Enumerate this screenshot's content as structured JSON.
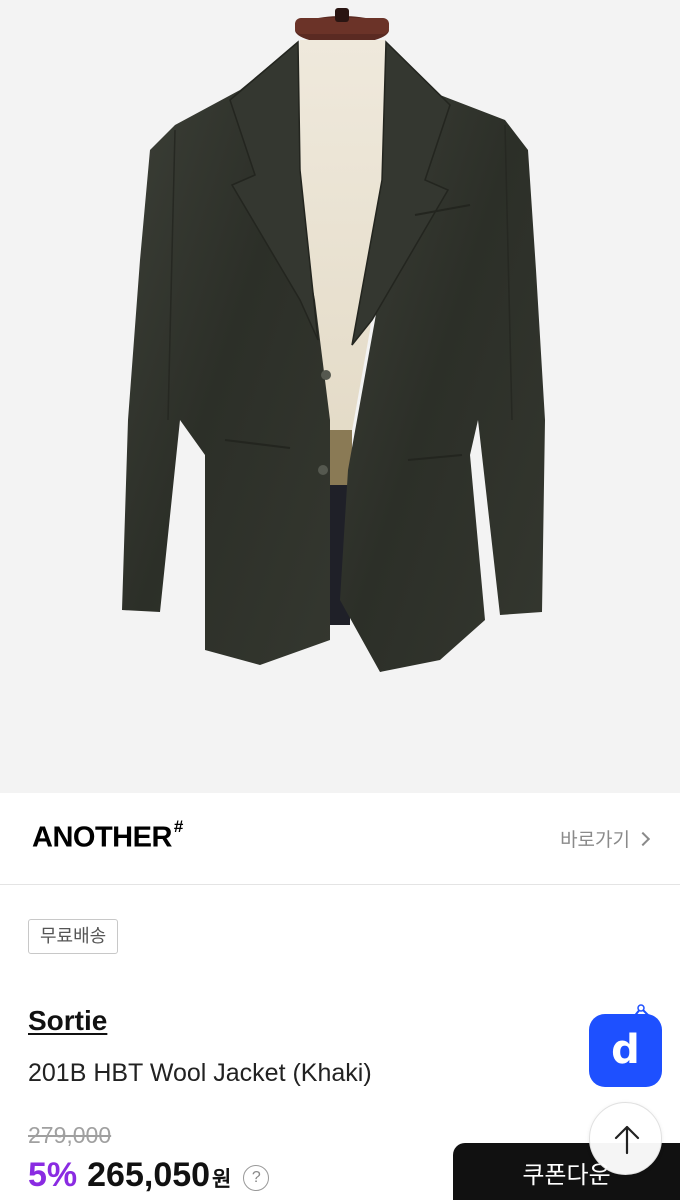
{
  "product_image": {
    "alt": "khaki wool jacket on mannequin",
    "bg_color": "#f3f3f3"
  },
  "brand": {
    "logo_text": "ANOTHER",
    "logo_mark": "#",
    "link_label": "바로가기"
  },
  "badge": {
    "label": "무료배송"
  },
  "product": {
    "seller": "Sortie",
    "name": "201B HBT Wool Jacket (Khaki)",
    "original_price": "279,000",
    "discount": "5%",
    "sale_price": "265,050",
    "currency": "원",
    "help_symbol": "?"
  },
  "actions": {
    "coupon_label": "쿠폰다운",
    "app_button_letter": "d"
  },
  "colors": {
    "discount": "#8a2be2",
    "app_button": "#1e50ff",
    "coupon_button": "#111111"
  }
}
